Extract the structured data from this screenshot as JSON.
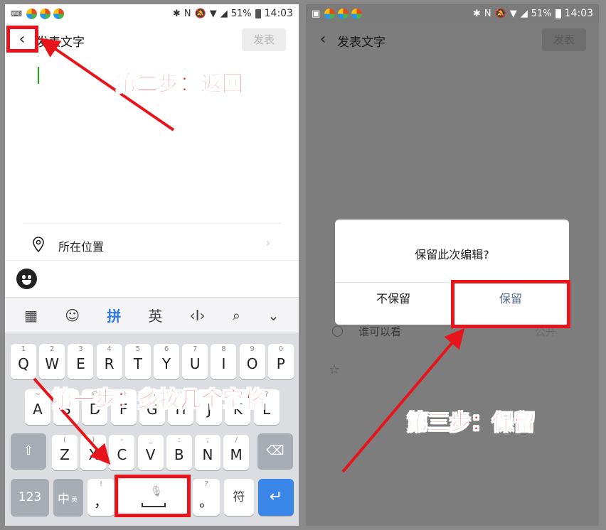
{
  "left": {
    "status": {
      "battery": "51%",
      "time": "14:03"
    },
    "header": {
      "title": "发表文字",
      "post_label": "发表"
    },
    "location_label": "所在位置",
    "toolbar": {
      "pinyin": "拼",
      "english": "英"
    },
    "keyboard": {
      "row1": [
        {
          "n": "1",
          "l": "Q"
        },
        {
          "n": "2",
          "l": "W"
        },
        {
          "n": "3",
          "l": "E"
        },
        {
          "n": "4",
          "l": "R"
        },
        {
          "n": "5",
          "l": "T"
        },
        {
          "n": "6",
          "l": "Y"
        },
        {
          "n": "7",
          "l": "U"
        },
        {
          "n": "8",
          "l": "I"
        },
        {
          "n": "9",
          "l": "O"
        },
        {
          "n": "0",
          "l": "P"
        }
      ],
      "row2": [
        {
          "n": "~",
          "l": "A"
        },
        {
          "n": "!",
          "l": "S"
        },
        {
          "n": "@",
          "l": "D"
        },
        {
          "n": "#",
          "l": "F"
        },
        {
          "n": "%",
          "l": "G"
        },
        {
          "n": "'",
          "l": "H"
        },
        {
          "n": "&",
          "l": "J"
        },
        {
          "n": "*",
          "l": "K"
        },
        {
          "n": "?",
          "l": "L"
        }
      ],
      "row3": [
        {
          "n": "(",
          "l": "Z"
        },
        {
          "n": ")",
          "l": "X"
        },
        {
          "n": "-",
          "l": "C"
        },
        {
          "n": "_",
          "l": "V"
        },
        {
          "n": ":",
          "l": "B"
        },
        {
          "n": ";",
          "l": "N"
        },
        {
          "n": "/",
          "l": "M"
        }
      ],
      "num_key": "123",
      "lang_key": "中",
      "lang_sub": "英",
      "comma_key": "，",
      "comma_sub": "!",
      "period_key": "。",
      "period_sub": "?",
      "symbol_key": "符"
    }
  },
  "right": {
    "status": {
      "battery": "51%",
      "time": "14:03"
    },
    "header": {
      "title": "发表文字",
      "post_label": "发表"
    },
    "background_who_label": "谁可以看",
    "background_who_value": "公开",
    "dialog": {
      "message": "保留此次编辑?",
      "discard": "不保留",
      "keep": "保留"
    }
  },
  "annotations": {
    "step1": "第一步：多按几个空格",
    "step2": "第二步：返回",
    "step3": "第三步：保留"
  },
  "colors": {
    "annotation_red": "#e8141b",
    "accent_green": "#1aad19",
    "dialog_link": "#576b95"
  }
}
